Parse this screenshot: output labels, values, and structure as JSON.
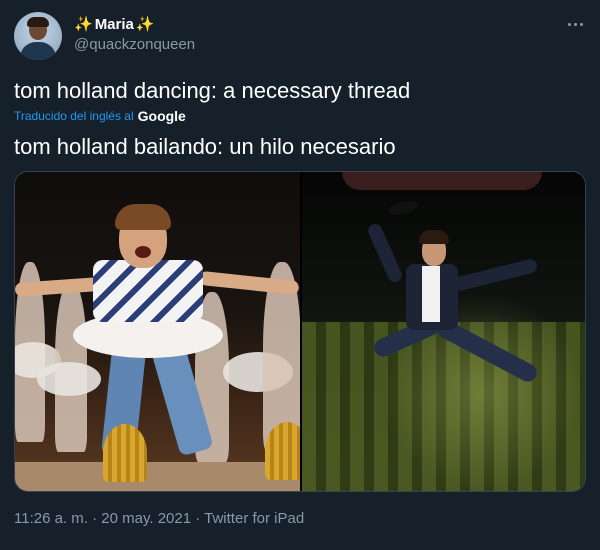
{
  "author": {
    "sparkle_left": "✨",
    "display_name": "Maria",
    "sparkle_right": "✨",
    "handle": "@quackzonqueen"
  },
  "tweet": {
    "text": "tom holland dancing: a necessary thread",
    "translated_label": "Traducido del inglés al",
    "translator_brand": "Google",
    "translation": "tom holland bailando: un hilo necesario"
  },
  "media": {
    "images": [
      "photo-ballet-boy",
      "photo-jumping-dancer"
    ]
  },
  "meta": {
    "time": "11:26 a. m.",
    "separator": "·",
    "date": "20 may. 2021",
    "source": "Twitter for iPad"
  },
  "colors": {
    "background": "#15202b",
    "secondary_text": "#8b98a5",
    "link": "#1d9bf0",
    "sparkle": "#f7c531"
  },
  "icons": {
    "more": "more-horizontal-icon",
    "sparkles": "sparkles-icon"
  }
}
